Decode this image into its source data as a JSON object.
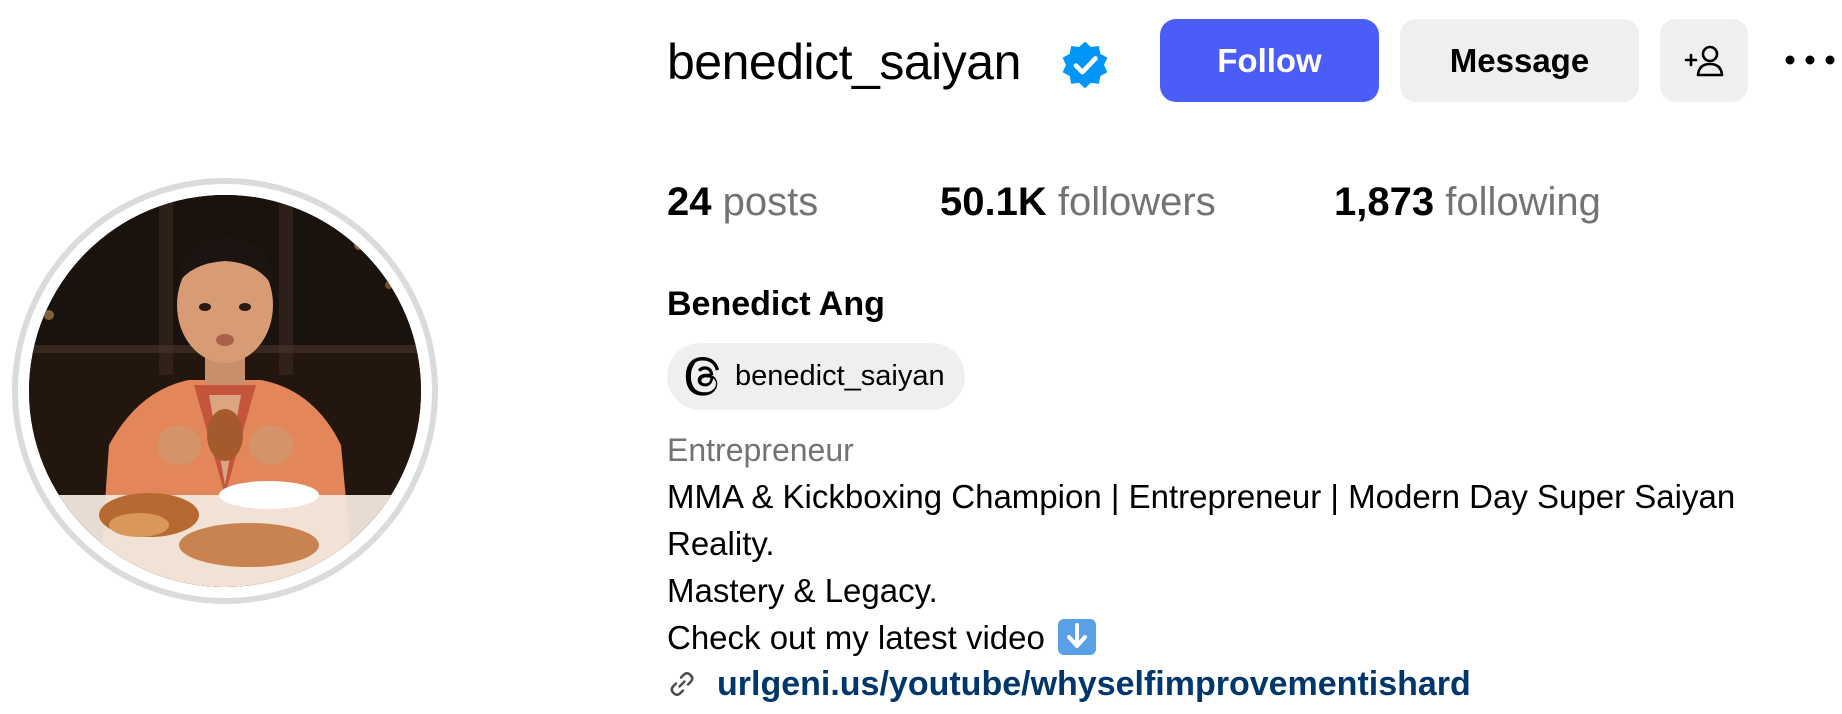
{
  "profile": {
    "username": "benedict_saiyan",
    "verified": true,
    "full_name": "Benedict Ang",
    "avatar_icon": "profile-photo"
  },
  "actions": {
    "follow_label": "Follow",
    "message_label": "Message",
    "add_user_icon": "add-user-icon",
    "more_icon": "more-options-icon"
  },
  "stats": {
    "posts_count": "24",
    "posts_label": "posts",
    "followers_count": "50.1K",
    "followers_label": "followers",
    "following_count": "1,873",
    "following_label": "following"
  },
  "threads": {
    "handle": "benedict_saiyan",
    "icon": "threads-icon"
  },
  "bio": {
    "category": "Entrepreneur",
    "line1": "MMA & Kickboxing Champion | Entrepreneur | Modern Day Super Saiyan",
    "line2": "Reality.",
    "line3": "Mastery & Legacy.",
    "line4": "Check out my latest video",
    "line4_emoji": "down-arrow-emoji",
    "link": "urlgeni.us/youtube/whyselfimprovementishard",
    "link_icon": "link-icon"
  },
  "colors": {
    "follow_button": "#4a5df9",
    "secondary_button": "#efefef",
    "muted_text": "#737373",
    "link_text": "#00376b",
    "verified_badge": "#0095f6"
  }
}
